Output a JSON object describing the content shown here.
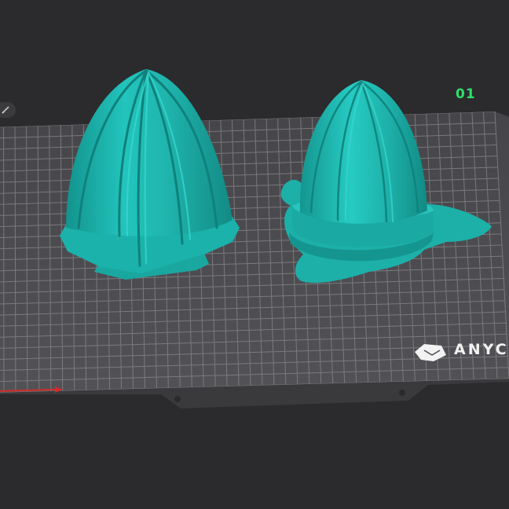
{
  "plate": {
    "number": "01",
    "brand_text": "ANYC"
  },
  "colors": {
    "background": "#2b2b2d",
    "plate_fill": "#4c4c4f",
    "grid_line": "#8a8a8d",
    "model_color": "#1fb5ae",
    "plate_number_color": "#2ee06a",
    "axis_x_color": "#d42a2a"
  },
  "icons": {
    "edit": "pencil-icon",
    "brand": "anycubic-logo-icon"
  },
  "models": [
    {
      "name": "citrus-reamer-cone-ribbed"
    },
    {
      "name": "citrus-reamer-cone-with-flange"
    }
  ]
}
